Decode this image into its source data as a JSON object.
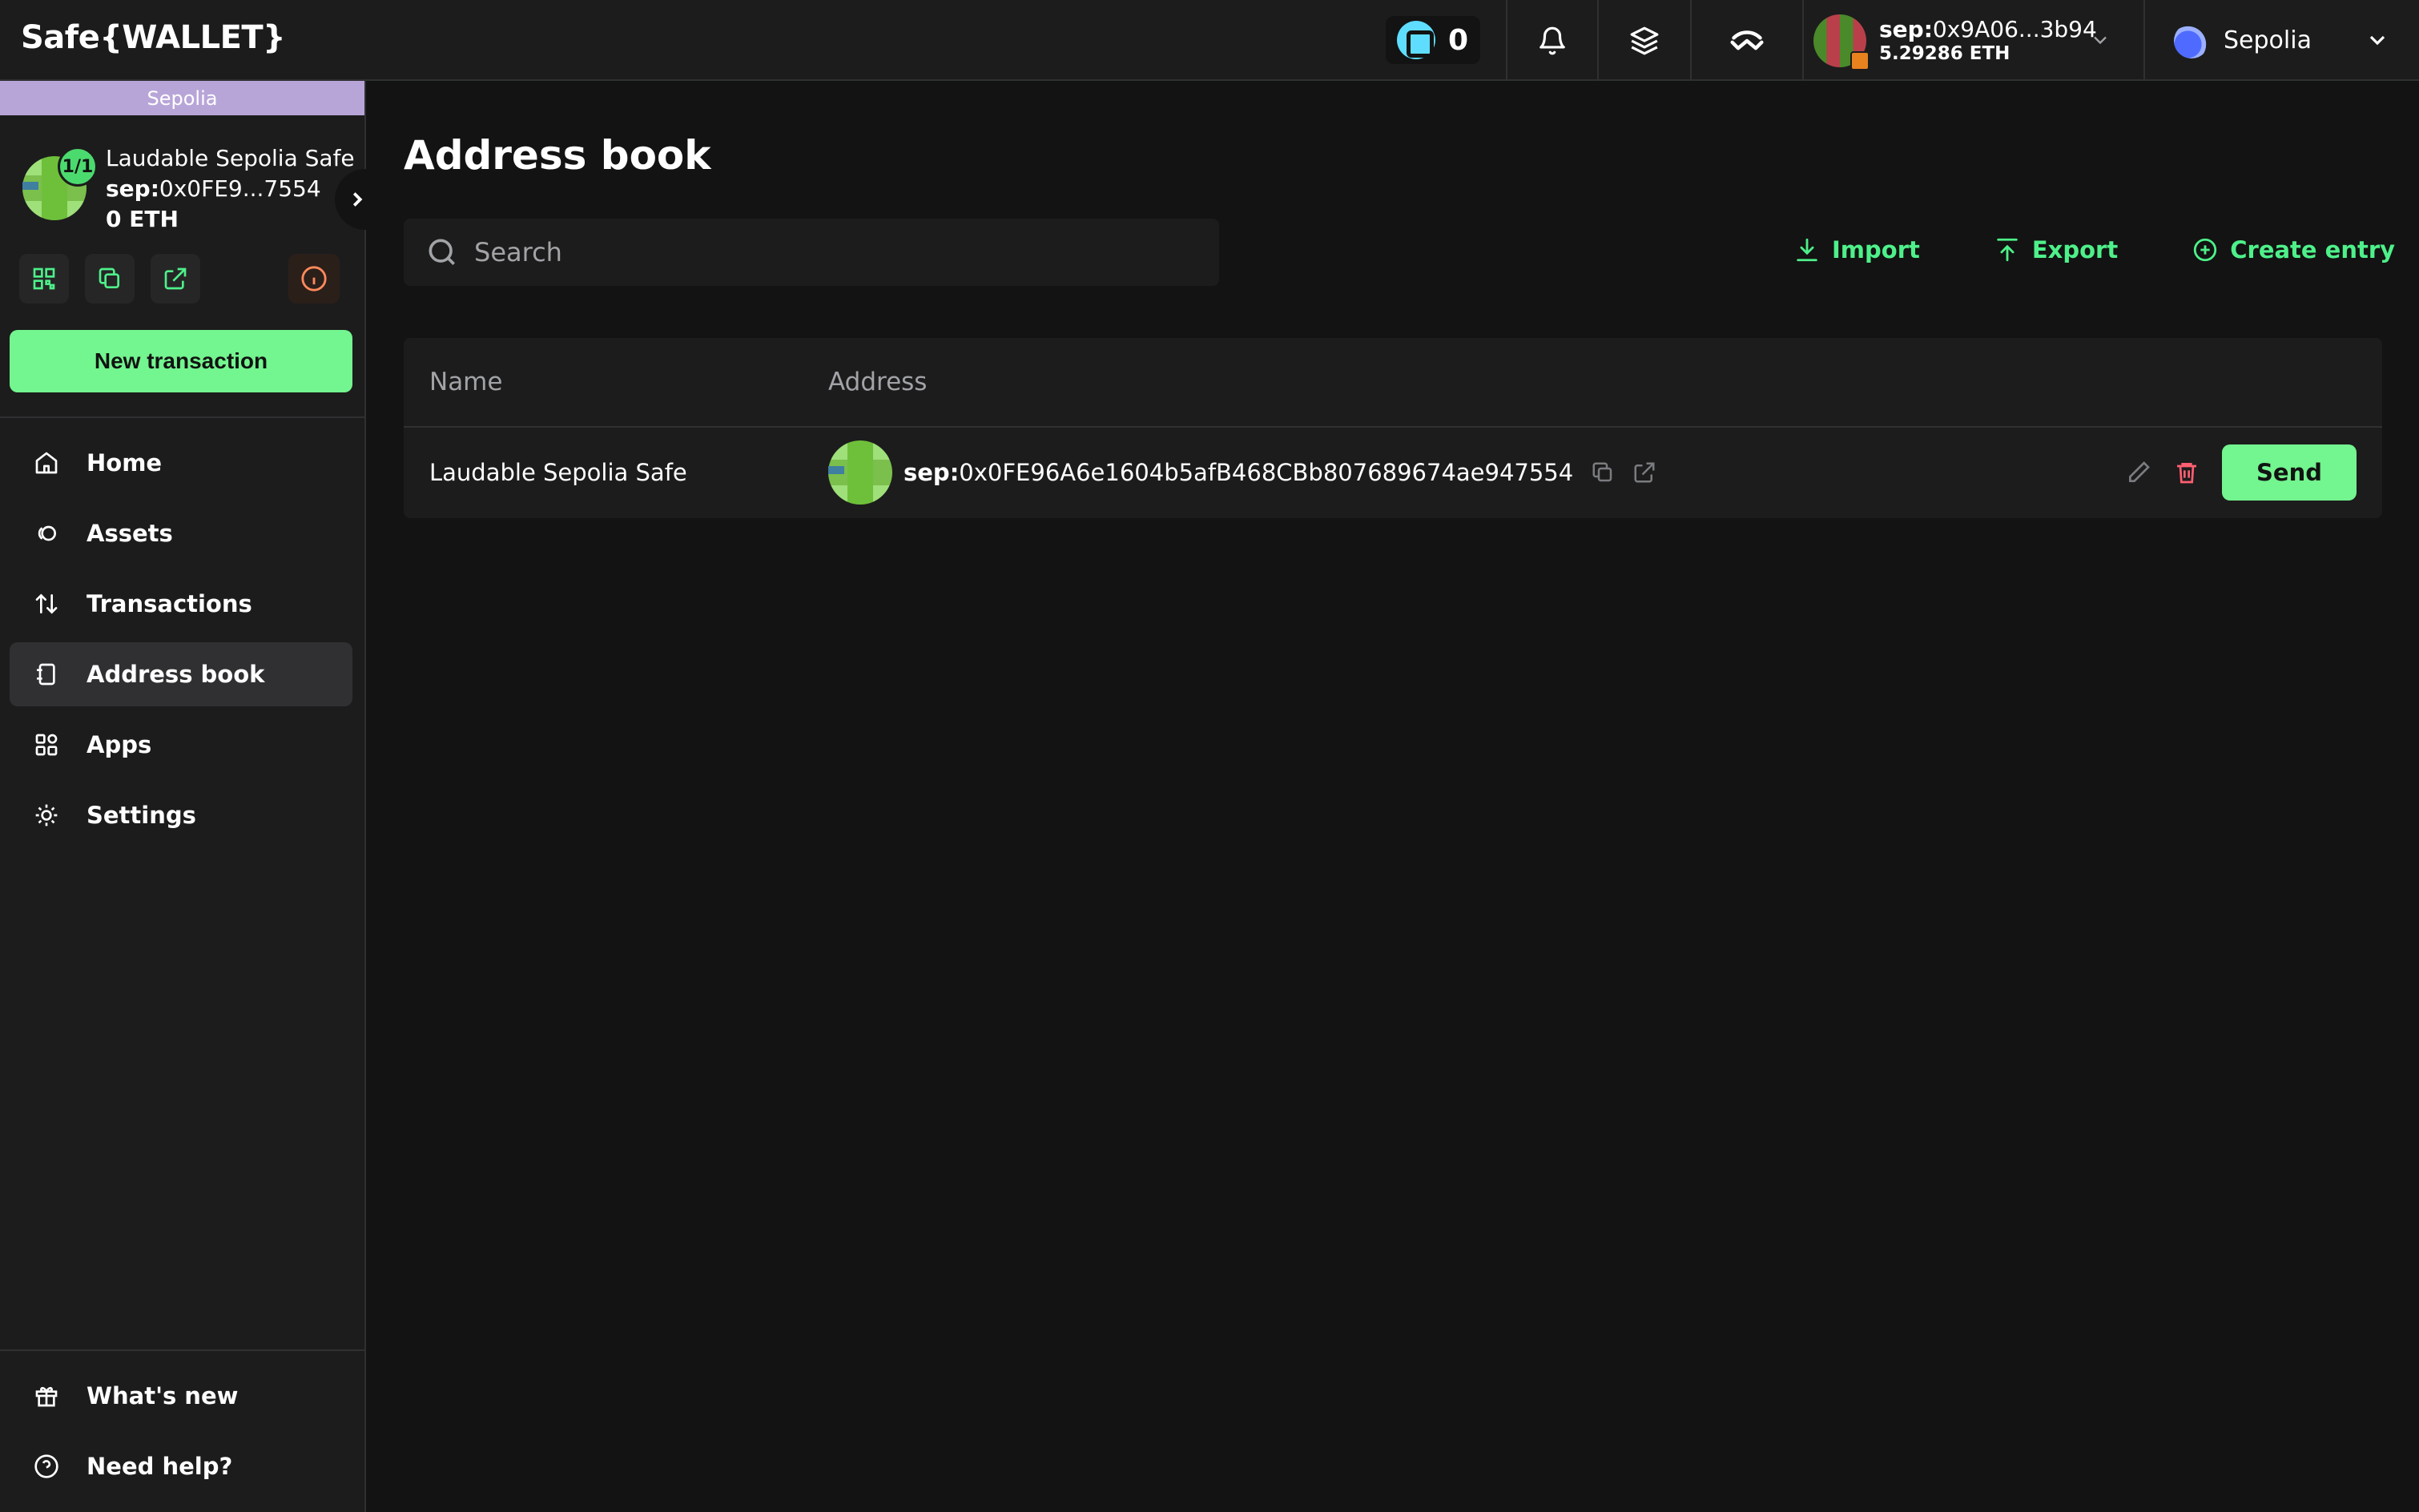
{
  "header": {
    "logo": "Safe{WALLET}",
    "points": "0",
    "account": {
      "prefix": "sep:",
      "address": "0x9A06...3b94",
      "balance": "5.29286 ETH"
    },
    "network": "Sepolia"
  },
  "sidebar": {
    "chain_label": "Sepolia",
    "safe": {
      "threshold": "1/1",
      "name": "Laudable Sepolia Safe",
      "prefix": "sep:",
      "address": "0x0FE9...7554",
      "balance": "0 ETH"
    },
    "new_tx_label": "New transaction",
    "nav": [
      {
        "label": "Home",
        "icon": "home-icon"
      },
      {
        "label": "Assets",
        "icon": "assets-icon"
      },
      {
        "label": "Transactions",
        "icon": "transactions-icon"
      },
      {
        "label": "Address book",
        "icon": "address-book-icon",
        "active": true
      },
      {
        "label": "Apps",
        "icon": "apps-icon"
      },
      {
        "label": "Settings",
        "icon": "settings-icon"
      }
    ],
    "bottom": [
      {
        "label": "What's new",
        "icon": "gift-icon"
      },
      {
        "label": "Need help?",
        "icon": "help-icon"
      }
    ]
  },
  "main": {
    "title": "Address book",
    "search_placeholder": "Search",
    "actions": {
      "import": "Import",
      "export": "Export",
      "create": "Create entry"
    },
    "columns": [
      "Name",
      "Address"
    ],
    "rows": [
      {
        "name": "Laudable Sepolia Safe",
        "prefix": "sep:",
        "address": "0x0FE96A6e1604b5afB468CBb807689674ae947554",
        "send_label": "Send"
      }
    ]
  },
  "colors": {
    "background": "#121312",
    "panel": "#1c1c1c",
    "accent": "#12ff80",
    "accent_button": "#73f58f",
    "chain_bar": "#b8a5d8",
    "danger": "#ff5f72"
  }
}
